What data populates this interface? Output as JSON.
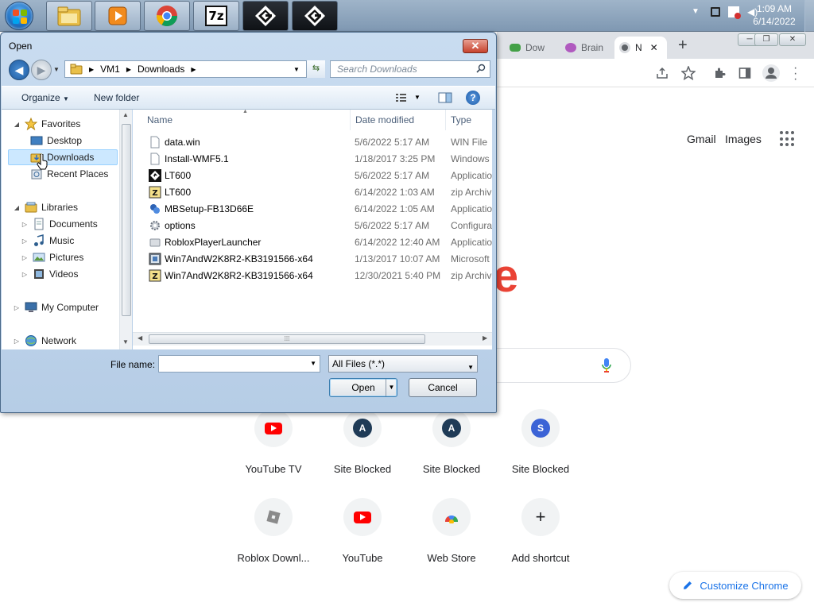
{
  "taskbar": {
    "clock_time": "1:09 AM",
    "clock_date": "6/14/2022",
    "apps": [
      {
        "name": "windows-explorer",
        "label": ""
      },
      {
        "name": "media-player",
        "label": ""
      },
      {
        "name": "chrome",
        "label": ""
      },
      {
        "name": "7zip",
        "label": "7z"
      },
      {
        "name": "lt600-a",
        "label": ""
      },
      {
        "name": "lt600-b",
        "label": ""
      }
    ]
  },
  "chrome": {
    "tabs": [
      {
        "label": "Dow"
      },
      {
        "label": "Brain"
      },
      {
        "label": "N"
      }
    ],
    "new_tab": "+",
    "links": {
      "gmail": "Gmail",
      "images": "Images"
    },
    "customize": "Customize Chrome",
    "shortcuts": [
      {
        "label": "YouTube TV",
        "letter": "",
        "color": "#ff0000"
      },
      {
        "label": "Site Blocked",
        "letter": "A",
        "color": "#1f3b57"
      },
      {
        "label": "Site Blocked",
        "letter": "A",
        "color": "#1f3b57"
      },
      {
        "label": "Site Blocked",
        "letter": "S",
        "color": "#3b63d6"
      },
      {
        "label": "Roblox Downl...",
        "letter": "",
        "color": "#9e9e9e"
      },
      {
        "label": "YouTube",
        "letter": "",
        "color": "#ff0000"
      },
      {
        "label": "Web Store",
        "letter": "",
        "color": ""
      },
      {
        "label": "Add shortcut",
        "letter": "+",
        "color": ""
      }
    ]
  },
  "dialog": {
    "title": "Open",
    "close": "✕",
    "path": [
      "VM1",
      "Downloads"
    ],
    "search_placeholder": "Search Downloads",
    "organize": "Organize",
    "new_folder": "New folder",
    "nav": {
      "favorites": "Favorites",
      "desktop": "Desktop",
      "downloads": "Downloads",
      "recent": "Recent Places",
      "libraries": "Libraries",
      "documents": "Documents",
      "music": "Music",
      "pictures": "Pictures",
      "videos": "Videos",
      "computer": "My Computer",
      "network": "Network"
    },
    "columns": {
      "name": "Name",
      "date": "Date modified",
      "type": "Type"
    },
    "files": [
      {
        "name": "data.win",
        "date": "5/6/2022 5:17 AM",
        "type": "WIN File",
        "icon": "file"
      },
      {
        "name": "Install-WMF5.1",
        "date": "1/18/2017 3:25 PM",
        "type": "Windows",
        "icon": "file"
      },
      {
        "name": "LT600",
        "date": "5/6/2022 5:17 AM",
        "type": "Applicatio",
        "icon": "app"
      },
      {
        "name": "LT600",
        "date": "6/14/2022 1:03 AM",
        "type": "zip Archiv",
        "icon": "zip"
      },
      {
        "name": "MBSetup-FB13D66E",
        "date": "6/14/2022 1:05 AM",
        "type": "Applicatio",
        "icon": "setup"
      },
      {
        "name": "options",
        "date": "5/6/2022 5:17 AM",
        "type": "Configura",
        "icon": "config"
      },
      {
        "name": "RobloxPlayerLauncher",
        "date": "6/14/2022 12:40 AM",
        "type": "Applicatio",
        "icon": "roblox"
      },
      {
        "name": "Win7AndW2K8R2-KB3191566-x64",
        "date": "1/13/2017 10:07 AM",
        "type": "Microsoft",
        "icon": "msu"
      },
      {
        "name": "Win7AndW2K8R2-KB3191566-x64",
        "date": "12/30/2021 5:40 PM",
        "type": "zip Archiv",
        "icon": "zip"
      }
    ],
    "file_name_label": "File name:",
    "file_name_value": "",
    "file_type": "All Files (*.*)",
    "open_btn": "Open",
    "cancel_btn": "Cancel"
  },
  "colors": {
    "accent": "#1a73e8",
    "selection": "#cce8ff",
    "close_red": "#c7422d"
  }
}
